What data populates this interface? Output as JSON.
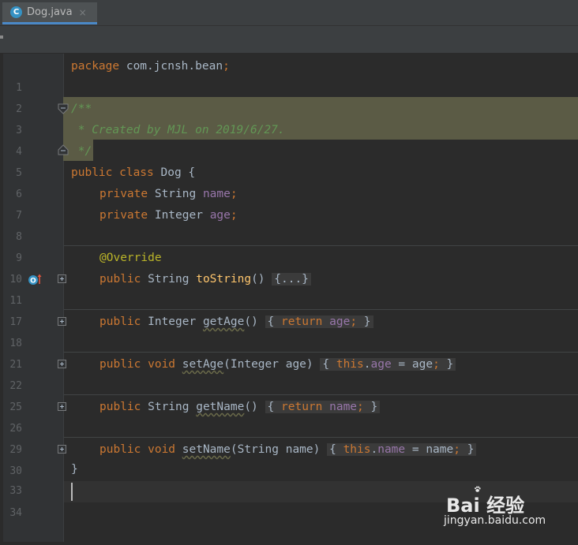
{
  "tab": {
    "icon_letter": "C",
    "filename": "Dog.java",
    "close": "×"
  },
  "lines": {
    "l1": {
      "num": "1",
      "package_kw": "package",
      "package_name": " com.jcnsh.bean",
      "semi": ";"
    },
    "l2": {
      "num": "2"
    },
    "l3": {
      "num": "3",
      "comment": "/**"
    },
    "l4": {
      "num": "4",
      "comment": " * Created by MJL on 2019/6/27."
    },
    "l5": {
      "num": "5",
      "comment": " */"
    },
    "l6": {
      "num": "6",
      "kw": "public class ",
      "name": "Dog",
      "brace": " {"
    },
    "l7": {
      "num": "7",
      "kw": "private ",
      "type": "String ",
      "field": "name",
      "semi": ";"
    },
    "l8": {
      "num": "8",
      "kw": "private ",
      "type": "Integer ",
      "field": "age",
      "semi": ";"
    },
    "l9": {
      "num": "9"
    },
    "l10": {
      "num": "10",
      "annotation": "@Override"
    },
    "l11": {
      "num": "11",
      "kw": "public ",
      "type": "String ",
      "method": "toString",
      "parens": "() ",
      "folded": "{...}"
    },
    "l17": {
      "num": "17"
    },
    "l18": {
      "num": "18",
      "kw": "public ",
      "type": "Integer ",
      "method": "getAge",
      "parens": "() ",
      "body_open": "{ ",
      "ret": "return ",
      "field": "age",
      "semi": ";",
      "body_close": " }"
    },
    "l21": {
      "num": "21"
    },
    "l22": {
      "num": "22",
      "kw": "public void ",
      "method": "setAge",
      "params": "(Integer age) ",
      "body_open": "{ ",
      "this_kw": "this",
      "dot": ".",
      "field": "age",
      "assign": " = age",
      "semi": ";",
      "body_close": " }"
    },
    "l25": {
      "num": "25"
    },
    "l26": {
      "num": "26",
      "kw": "public ",
      "type": "String ",
      "method": "getName",
      "parens": "() ",
      "body_open": "{ ",
      "ret": "return ",
      "field": "name",
      "semi": ";",
      "body_close": " }"
    },
    "l29": {
      "num": "29"
    },
    "l30": {
      "num": "30",
      "kw": "public void ",
      "method": "setName",
      "params": "(String name) ",
      "body_open": "{ ",
      "this_kw": "this",
      "dot": ".",
      "field": "name",
      "assign": " = name",
      "semi": ";",
      "body_close": " }"
    },
    "l33": {
      "num": "33",
      "brace": "}"
    },
    "l34": {
      "num": "34"
    }
  },
  "override_icon_letter": "O",
  "watermark": {
    "brand": "Bai  经验",
    "url": "jingyan.baidu.com"
  },
  "colors": {
    "keyword": "#cc7832",
    "field": "#9876aa",
    "annotation": "#bbb529",
    "method": "#ffc66d",
    "comment": "#629755",
    "text": "#a9b7c6",
    "tab_underline": "#4a88c7"
  }
}
